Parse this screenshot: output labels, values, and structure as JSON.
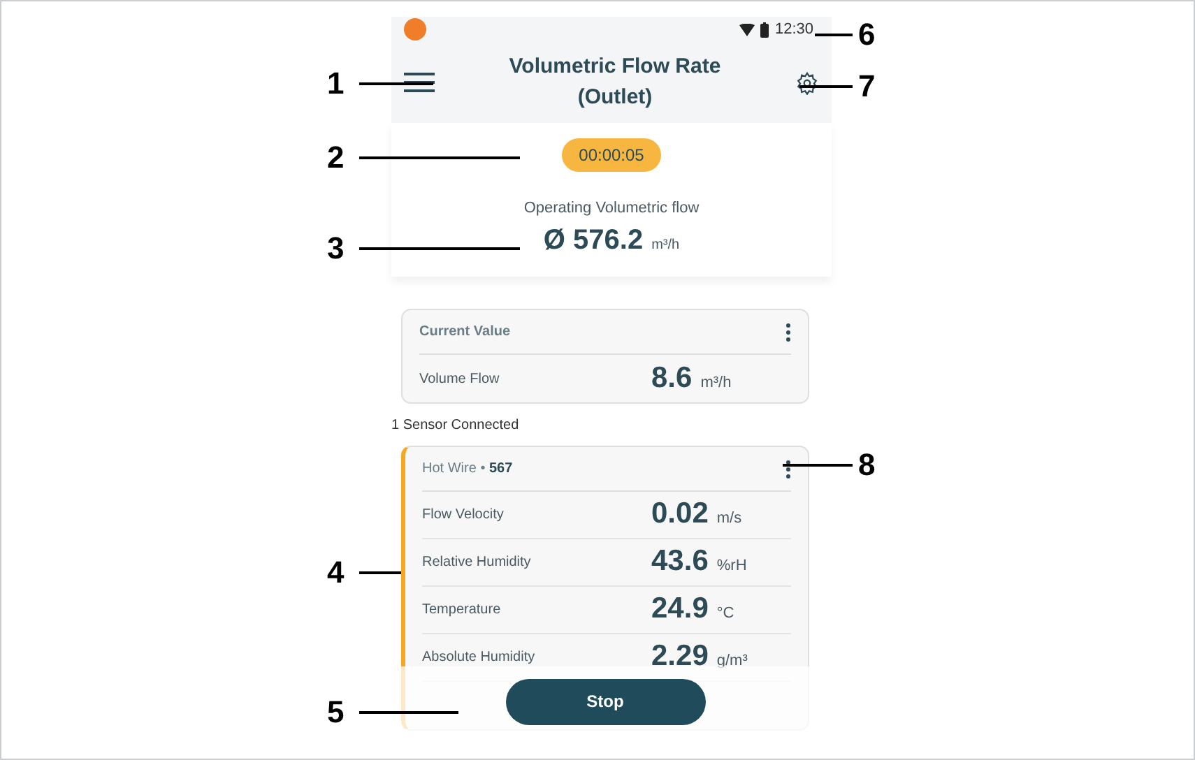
{
  "status_bar": {
    "time": "12:30"
  },
  "header": {
    "title_lines": [
      "Volumetric Flow Rate",
      "(Outlet)"
    ]
  },
  "timer": "00:00:05",
  "summary": {
    "label": "Operating Volumetric flow",
    "value": "Ø 576.2",
    "unit": "m³/h"
  },
  "current_card": {
    "title": "Current Value",
    "rows": [
      {
        "label": "Volume Flow",
        "value": "8.6",
        "unit": "m³/h"
      }
    ]
  },
  "sensor_count": "1 Sensor Connected",
  "sensor_card": {
    "name": "Hot Wire",
    "separator": "•",
    "serial": "567",
    "color": "#f5a623",
    "rows": [
      {
        "label": "Flow Velocity",
        "value": "0.02",
        "unit": "m/s"
      },
      {
        "label": "Relative Humidity",
        "value": "43.6",
        "unit": "%rH"
      },
      {
        "label": "Temperature",
        "value": "24.9",
        "unit": "°C"
      },
      {
        "label": "Absolute Humidity",
        "value": "2.29",
        "unit": "g/m³"
      }
    ]
  },
  "stop_button": "Stop",
  "callouts": [
    "1",
    "2",
    "3",
    "4",
    "5",
    "6",
    "7",
    "8"
  ]
}
